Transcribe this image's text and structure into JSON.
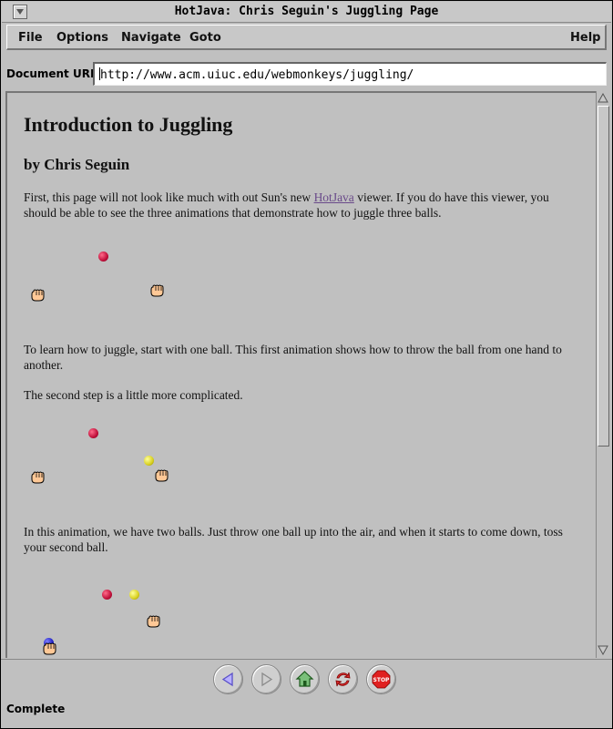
{
  "window": {
    "title": "HotJava: Chris Seguin's Juggling Page"
  },
  "menubar": {
    "file": "File",
    "options": "Options",
    "navigate": "Navigate",
    "goto": "Goto",
    "help": "Help"
  },
  "address": {
    "label": "Document URL:",
    "value": "http://www.acm.uiuc.edu/webmonkeys/juggling/"
  },
  "page": {
    "heading": "Introduction to Juggling",
    "byline": "by Chris Seguin",
    "intro_before_link": "First, this page will not look like much with out Sun's new ",
    "intro_link": "HotJava",
    "intro_after_link": " viewer. If you do have this viewer, you should be able to see the three animations that demonstrate how to juggle three balls.",
    "para_one_ball": "To learn how to juggle, start with one ball. This first animation shows how to throw the ball from one hand to another.",
    "para_second_step": "The second step is a little more complicated.",
    "para_two_balls": "In this animation, we have two balls. Just throw one ball up into the air, and when it starts to come down, toss your second ball."
  },
  "toolbar": {
    "back_icon": "back-arrow-icon",
    "forward_icon": "forward-arrow-icon",
    "home_icon": "home-icon",
    "reload_icon": "reload-icon",
    "stop_icon": "stop-sign-icon",
    "stop_label": "STOP"
  },
  "status": {
    "text": "Complete"
  },
  "colors": {
    "link": "#6a4a8a",
    "background": "#c0c0c0",
    "hand": "#ffc896"
  }
}
